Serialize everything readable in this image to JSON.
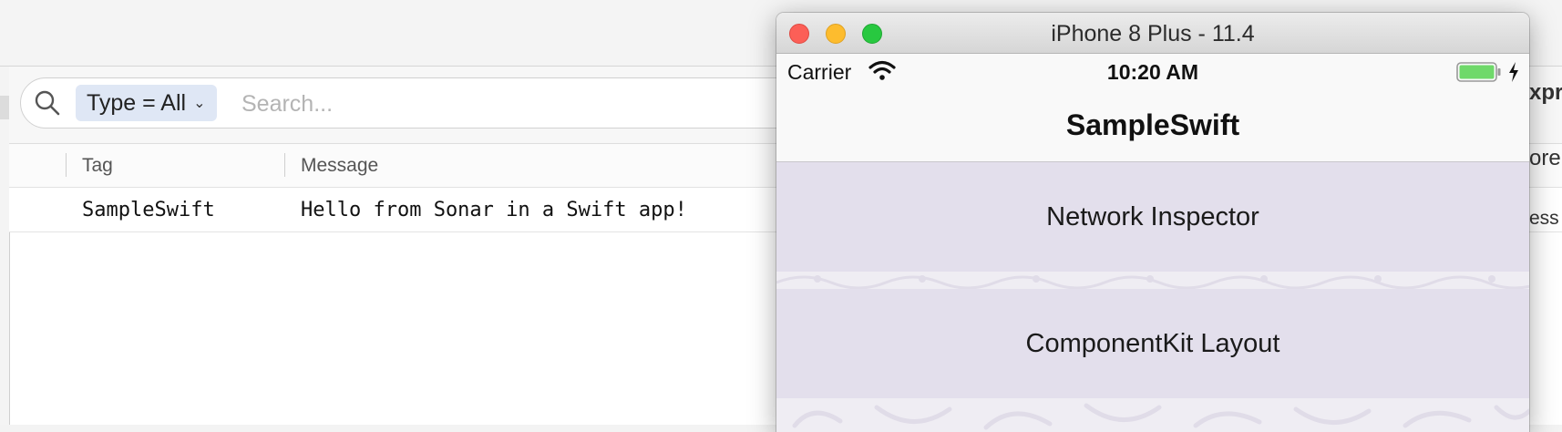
{
  "logs_view": {
    "filter": {
      "type_token": "Type = All",
      "search_placeholder": "Search..."
    },
    "columns": {
      "tag": "Tag",
      "message": "Message"
    },
    "rows": [
      {
        "tag": "SampleSwift",
        "message": "Hello from Sonar in a Swift app!"
      }
    ],
    "clipped_right": [
      "xpr",
      "ore",
      "ess"
    ]
  },
  "simulator": {
    "window_title": "iPhone 8 Plus - 11.4",
    "status_bar": {
      "carrier": "Carrier",
      "time": "10:20 AM"
    },
    "nav_title": "SampleSwift",
    "buttons": [
      {
        "label": "Network Inspector"
      },
      {
        "label": "ComponentKit Layout"
      }
    ]
  },
  "colors": {
    "accent_pill": "#dfe7f5",
    "button_bg": "#e3dfec",
    "battery": "#6fd96a",
    "traffic_close": "#fc5f57",
    "traffic_min": "#fdbc2e",
    "traffic_max": "#28c840"
  }
}
